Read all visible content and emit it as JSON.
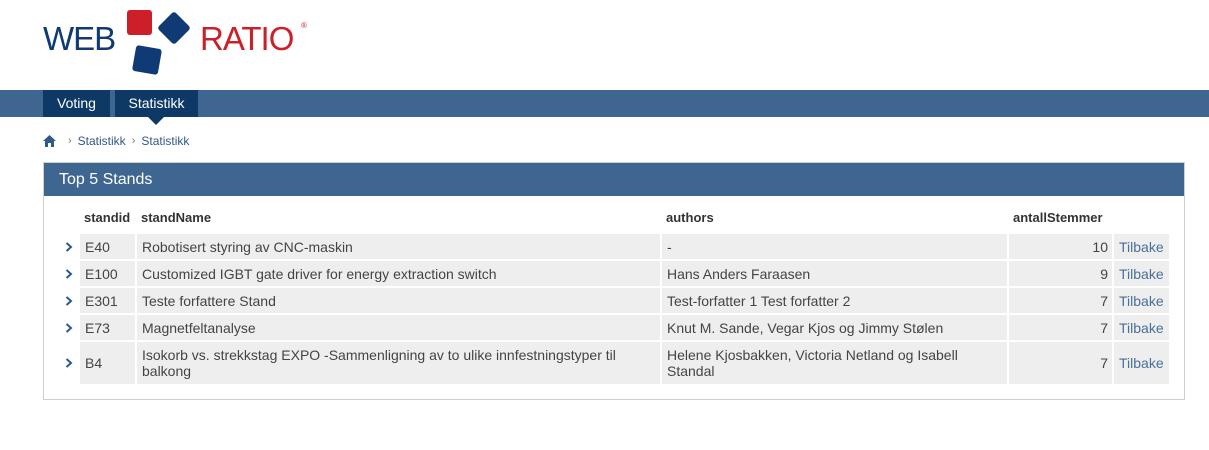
{
  "logo": {
    "left": "WEB",
    "right": "RATIO",
    "reg": "®"
  },
  "nav": {
    "tabs": [
      "Voting",
      "Statistikk"
    ]
  },
  "breadcrumb": {
    "items": [
      "Statistikk",
      "Statistikk"
    ],
    "separator": "›"
  },
  "panel": {
    "title": "Top 5 Stands",
    "columns": {
      "id": "standid",
      "name": "standName",
      "authors": "authors",
      "votes": "antallStemmer"
    },
    "rows": [
      {
        "id": "E40",
        "name": "Robotisert styring av CNC-maskin",
        "authors": "-",
        "votes": "10",
        "action": "Tilbake"
      },
      {
        "id": "E100",
        "name": "Customized IGBT gate driver for energy extraction switch",
        "authors": "Hans Anders Faraasen",
        "votes": "9",
        "action": "Tilbake"
      },
      {
        "id": "E301",
        "name": "Teste forfattere Stand",
        "authors": "Test-forfatter 1 Test forfatter 2",
        "votes": "7",
        "action": "Tilbake"
      },
      {
        "id": "E73",
        "name": "Magnetfeltanalyse",
        "authors": "Knut M. Sande, Vegar Kjos og Jimmy Stølen",
        "votes": "7",
        "action": "Tilbake"
      },
      {
        "id": "B4",
        "name": "Isokorb vs. strekkstag EXPO -Sammenligning av to ulike innfestningstyper til balkong",
        "authors": "Helene Kjosbakken, Victoria Netland og Isabell Standal",
        "votes": "7",
        "action": "Tilbake"
      }
    ]
  },
  "colors": {
    "navbar": "#3e6690",
    "tab": "#0e3866",
    "brand_red": "#cc1f2a",
    "brand_blue": "#0f3a73",
    "link": "#4a6f9a"
  }
}
